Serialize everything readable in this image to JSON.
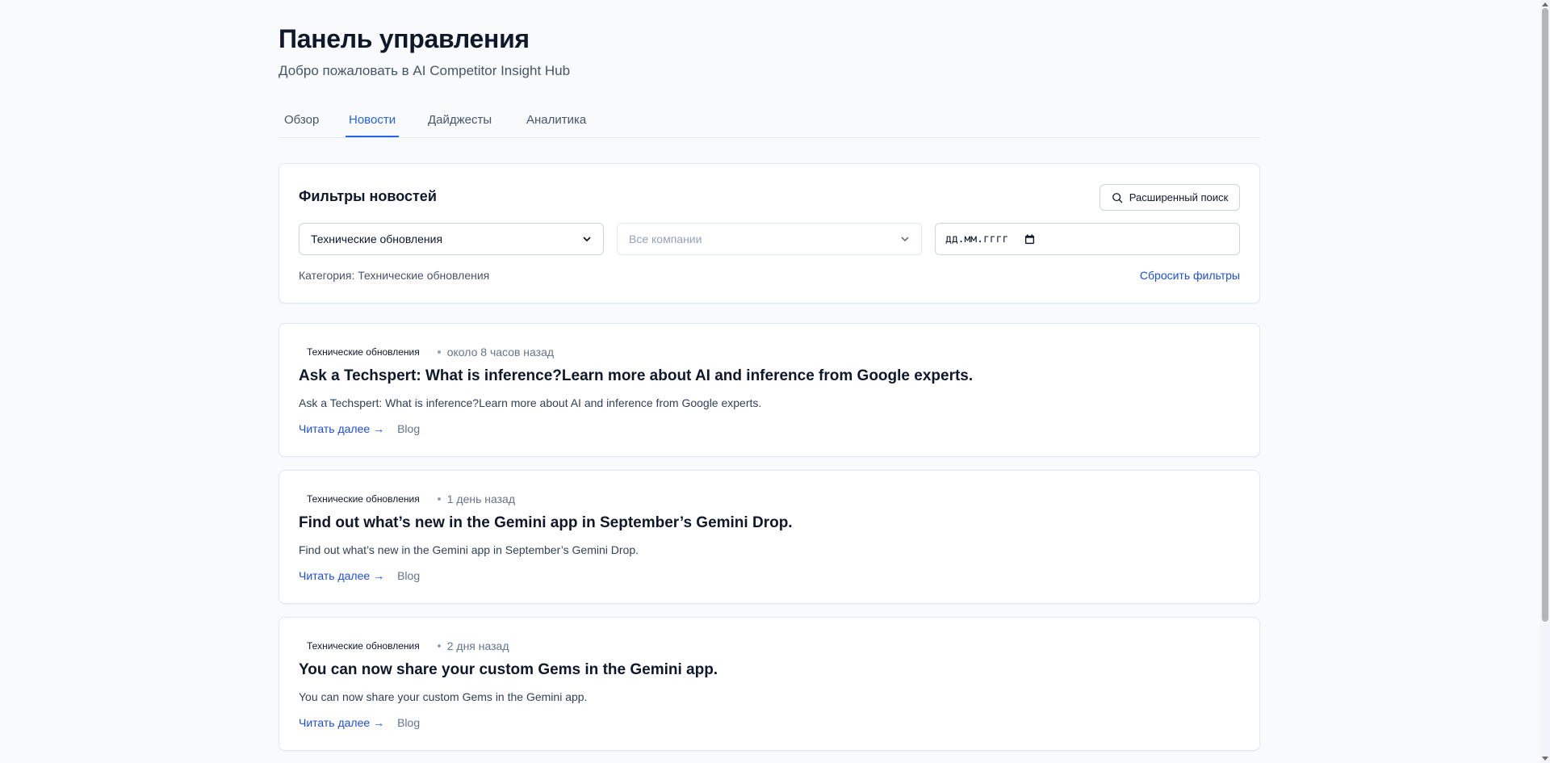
{
  "header": {
    "title": "Панель управления",
    "subtitle": "Добро пожаловать в AI Competitor Insight Hub"
  },
  "tabs": [
    {
      "label": "Обзор",
      "active": false
    },
    {
      "label": "Новости",
      "active": true
    },
    {
      "label": "Дайджесты",
      "active": false
    },
    {
      "label": "Аналитика",
      "active": false
    }
  ],
  "filters": {
    "title": "Фильтры новостей",
    "advanced_search_label": "Расширенный поиск",
    "category_select": {
      "value": "Технические обновления"
    },
    "company_select": {
      "placeholder": "Все компании"
    },
    "date_input": {
      "placeholder": "дд.мм.гггг"
    },
    "summary": "Категория: Технические обновления",
    "reset_label": "Сбросить фильтры"
  },
  "news": [
    {
      "category": "Технические обновления",
      "time": "около 8 часов назад",
      "title": "Ask a Techspert: What is inference?Learn more about AI and inference from Google experts.",
      "description": "Ask a Techspert: What is inference?Learn more about AI and inference from Google experts.",
      "read_more": "Читать далее →",
      "source": "Blog"
    },
    {
      "category": "Технические обновления",
      "time": "1 день назад",
      "title": "Find out what’s new in the Gemini app in September’s Gemini Drop.",
      "description": "Find out what’s new in the Gemini app in September’s Gemini Drop.",
      "read_more": "Читать далее →",
      "source": "Blog"
    },
    {
      "category": "Технические обновления",
      "time": "2 дня назад",
      "title": "You can now share your custom Gems in the Gemini app.",
      "description": "You can now share your custom Gems in the Gemini app.",
      "read_more": "Читать далее →",
      "source": "Blog"
    }
  ],
  "colors": {
    "accent": "#2563eb",
    "link": "#1d4ed8",
    "background": "#f8fafc",
    "border": "#e2e8f0"
  },
  "icons": {
    "advanced_search": "search-icon",
    "select_arrow": "chevron-down-icon",
    "date_picker": "calendar-icon"
  }
}
